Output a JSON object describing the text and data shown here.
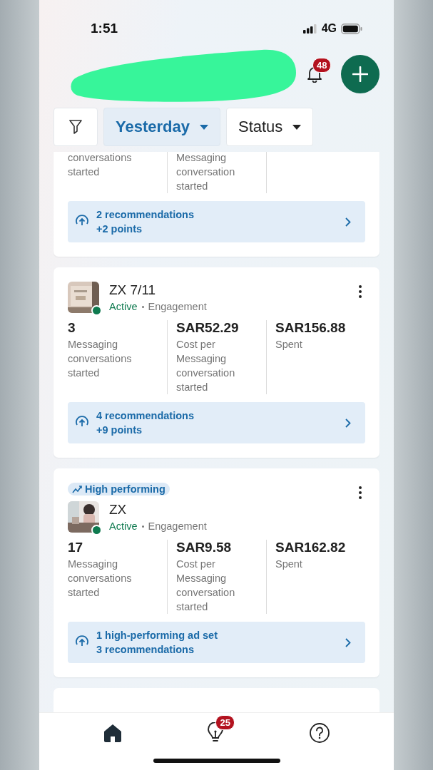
{
  "status_bar": {
    "time": "1:51",
    "network": "4G"
  },
  "header": {
    "notification_count": "48"
  },
  "filters": [
    {
      "label": "Yesterday",
      "selected": true
    },
    {
      "label": "Status",
      "selected": false
    }
  ],
  "cards": [
    {
      "metrics": [
        {
          "label": "conversations started"
        },
        {
          "label": "Messaging conversation started"
        }
      ],
      "recommendation": {
        "title": "2 recommendations",
        "subtitle": "+2 points"
      }
    },
    {
      "name": "ZX 7/11",
      "active": true,
      "status": "Active",
      "objective": "Engagement",
      "metrics": [
        {
          "value": "3",
          "label": "Messaging conversations started"
        },
        {
          "value": "SAR52.29",
          "label": "Cost per Messaging conversation started"
        },
        {
          "value": "SAR156.88",
          "label": "Spent"
        }
      ],
      "recommendation": {
        "title": "4 recommendations",
        "subtitle": "+9 points"
      }
    },
    {
      "badge": "High performing",
      "name": "ZX",
      "active": true,
      "status": "Active",
      "objective": "Engagement",
      "metrics": [
        {
          "value": "17",
          "label": "Messaging conversations started"
        },
        {
          "value": "SAR9.58",
          "label": "Cost per Messaging conversation started"
        },
        {
          "value": "SAR162.82",
          "label": "Spent"
        }
      ],
      "recommendation": {
        "title": "1 high-performing ad set",
        "subtitle": "3 recommendations"
      }
    }
  ],
  "bottom_nav": {
    "insights_count": "25"
  }
}
